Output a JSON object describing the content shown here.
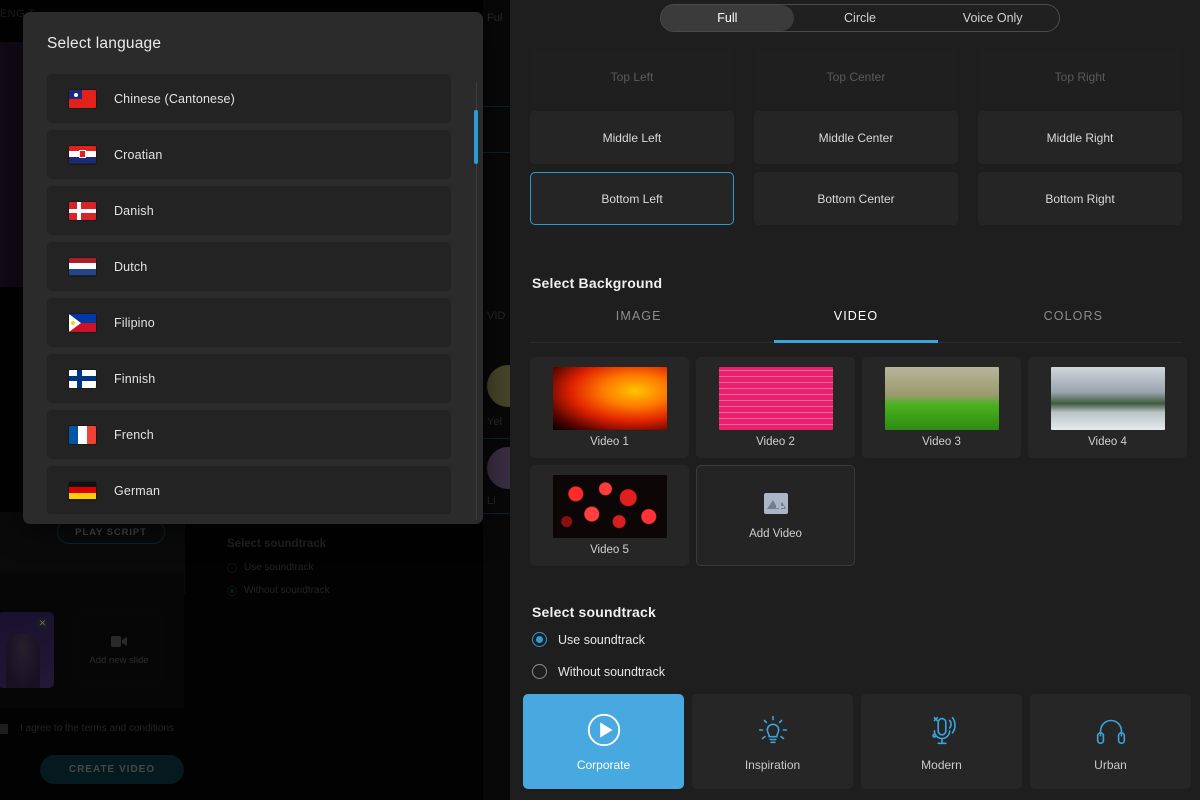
{
  "modal": {
    "title": "Select language",
    "languages": [
      {
        "label": "Chinese (Cantonese)",
        "flag": "flag-taiwan-icon"
      },
      {
        "label": "Croatian",
        "flag": "flag-croatia-icon"
      },
      {
        "label": "Danish",
        "flag": "flag-denmark-icon"
      },
      {
        "label": "Dutch",
        "flag": "flag-netherlands-icon"
      },
      {
        "label": "Filipino",
        "flag": "flag-philippines-icon"
      },
      {
        "label": "Finnish",
        "flag": "flag-finland-icon"
      },
      {
        "label": "French",
        "flag": "flag-france-icon"
      },
      {
        "label": "German",
        "flag": "flag-germany-icon"
      }
    ]
  },
  "panel": {
    "mode_tabs": [
      {
        "label": "Full",
        "active": true
      },
      {
        "label": "Circle",
        "active": false
      },
      {
        "label": "Voice Only",
        "active": false
      }
    ],
    "positions": [
      {
        "label": "Top Left",
        "state": "disabled"
      },
      {
        "label": "Top Center",
        "state": "disabled"
      },
      {
        "label": "Top Right",
        "state": "disabled"
      },
      {
        "label": "Middle Left",
        "state": "normal"
      },
      {
        "label": "Middle Center",
        "state": "normal"
      },
      {
        "label": "Middle Right",
        "state": "normal"
      },
      {
        "label": "Bottom Left",
        "state": "selected"
      },
      {
        "label": "Bottom Center",
        "state": "normal"
      },
      {
        "label": "Bottom Right",
        "state": "normal"
      }
    ],
    "background": {
      "title": "Select Background",
      "tabs": [
        {
          "label": "IMAGE",
          "active": false
        },
        {
          "label": "VIDEO",
          "active": true
        },
        {
          "label": "COLORS",
          "active": false
        }
      ],
      "videos": [
        {
          "label": "Video 1",
          "thumb": "fire-embers-thumb"
        },
        {
          "label": "Video 2",
          "thumb": "pink-brick-wall-thumb"
        },
        {
          "label": "Video 3",
          "thumb": "green-grass-thumb"
        },
        {
          "label": "Video 4",
          "thumb": "sea-clouds-thumb"
        },
        {
          "label": "Video 5",
          "thumb": "red-bokeh-thumb"
        }
      ],
      "add_video_label": "Add Video"
    },
    "soundtrack": {
      "title": "Select soundtrack",
      "options": [
        {
          "label": "Use soundtrack",
          "selected": true
        },
        {
          "label": "Without soundtrack",
          "selected": false
        }
      ],
      "tracks": [
        {
          "label": "Corporate",
          "icon": "play-circle-icon",
          "active": true
        },
        {
          "label": "Inspiration",
          "icon": "lightbulb-icon",
          "active": false
        },
        {
          "label": "Modern",
          "icon": "microphone-icon",
          "active": false
        },
        {
          "label": "Urban",
          "icon": "headphones-icon",
          "active": false
        }
      ]
    }
  },
  "background_page": {
    "top_chip": "ENG  T",
    "play_script_label": "PLAY SCRIPT",
    "soundtrack_title": "Select soundtrack",
    "soundtrack_option_1": "Use soundtrack",
    "soundtrack_option_2": "Without soundtrack",
    "add_slide_label": "Add new slide",
    "terms_label": "I agree to the terms and conditions",
    "create_video_label": "CREATE VIDEO",
    "sliver_full": "Ful",
    "sliver_video": "VID",
    "sliver_yellow": "Yel",
    "sliver_lilac": "Li"
  },
  "colors": {
    "accent": "#2f9bd4",
    "accent_soft": "#47a9e0",
    "panel_bg": "#1e1e1e",
    "modal_bg": "#2b2b2b",
    "card_bg": "#262626"
  }
}
